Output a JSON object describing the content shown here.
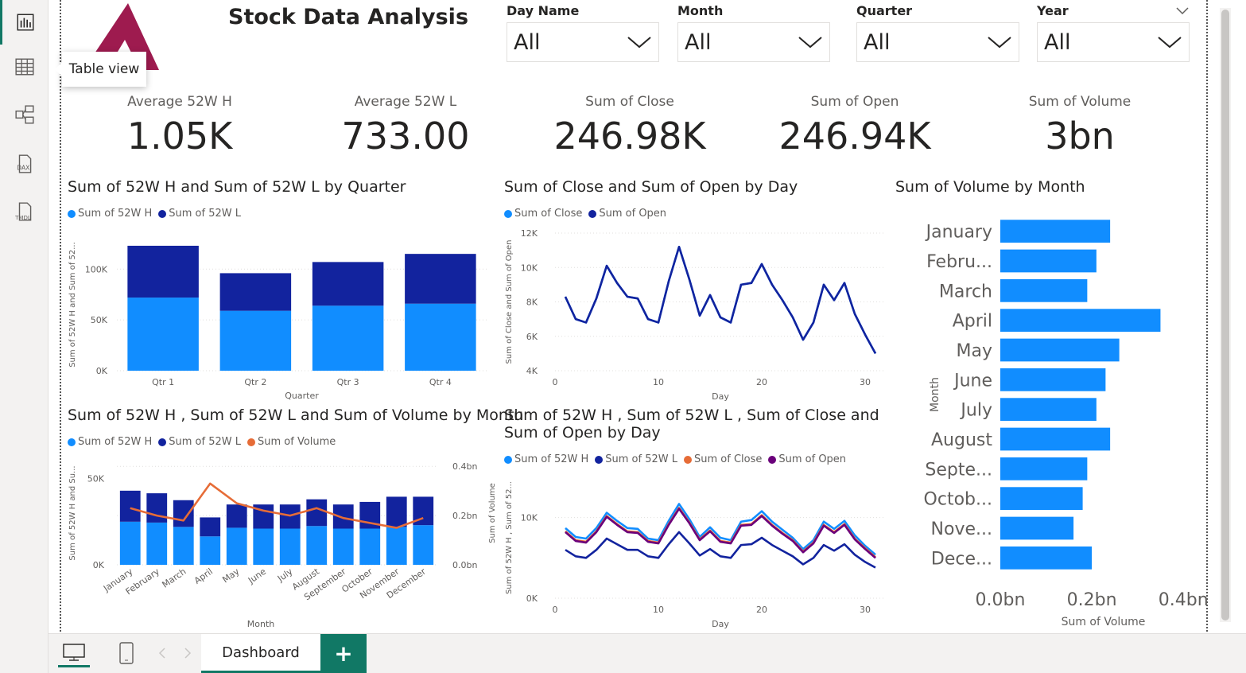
{
  "rail": {
    "items": [
      "report-view",
      "table-view",
      "model-view",
      "dax-query-view",
      "tmdl-view"
    ],
    "tooltip": "Table view",
    "dax_label": "DAX",
    "tmdl_label": "TMDL"
  },
  "header": {
    "title": "Stock Data Analysis"
  },
  "slicers": [
    {
      "label": "Day Name",
      "value": "All"
    },
    {
      "label": "Month",
      "value": "All"
    },
    {
      "label": "Quarter",
      "value": "All"
    },
    {
      "label": "Year",
      "value": "All"
    }
  ],
  "kpis": [
    {
      "label": "Average 52W H",
      "value": "1.05K"
    },
    {
      "label": "Average 52W L",
      "value": "733.00"
    },
    {
      "label": "Sum of Close",
      "value": "246.98K"
    },
    {
      "label": "Sum of Open",
      "value": "246.94K"
    },
    {
      "label": "Sum of Volume",
      "value": "3bn"
    }
  ],
  "colors": {
    "light_blue": "#118DFF",
    "dark_blue": "#12239E",
    "orange": "#E66C37",
    "purple": "#6B007B",
    "accent_green": "#117865",
    "logo": "#9E1B4F"
  },
  "chart_data": [
    {
      "type": "bar",
      "stacked": true,
      "title": "Sum of 52W H and Sum of 52W L by Quarter",
      "xlabel": "Quarter",
      "ylabel": "Sum of 52W H and Sum of 52...",
      "categories": [
        "Qtr 1",
        "Qtr 2",
        "Qtr 3",
        "Qtr 4"
      ],
      "series": [
        {
          "name": "Sum of 52W H",
          "values": [
            72000,
            59000,
            64000,
            66000
          ]
        },
        {
          "name": "Sum of 52W L",
          "values": [
            51000,
            37000,
            43000,
            49000
          ]
        }
      ],
      "ylim": [
        0,
        130000
      ],
      "yticks": [
        "0K",
        "50K",
        "100K"
      ],
      "ytick_values": [
        0,
        50000,
        100000
      ]
    },
    {
      "type": "line",
      "title": "Sum of Close and Sum of Open by Day",
      "xlabel": "Day",
      "ylabel": "Sum of Close and Sum of Open",
      "x": [
        1,
        2,
        3,
        4,
        5,
        6,
        7,
        8,
        9,
        10,
        11,
        12,
        13,
        14,
        15,
        16,
        17,
        18,
        19,
        20,
        21,
        22,
        23,
        24,
        25,
        26,
        27,
        28,
        29,
        30,
        31
      ],
      "series": [
        {
          "name": "Sum of Close",
          "values": [
            8300,
            7000,
            6800,
            8200,
            10100,
            9100,
            8300,
            8200,
            7000,
            6800,
            9200,
            11200,
            9300,
            7200,
            8400,
            7100,
            6800,
            9000,
            9100,
            10200,
            9000,
            8100,
            7100,
            5800,
            6800,
            9000,
            8100,
            9100,
            7300,
            6100,
            5000
          ]
        },
        {
          "name": "Sum of Open",
          "values": [
            8300,
            7000,
            6800,
            8200,
            10100,
            9100,
            8300,
            8200,
            7000,
            6800,
            9200,
            11200,
            9300,
            7200,
            8400,
            7100,
            6800,
            9000,
            9100,
            10200,
            9000,
            8100,
            7100,
            5800,
            6800,
            9000,
            8100,
            9100,
            7300,
            6100,
            5000
          ]
        }
      ],
      "xlim": [
        0,
        32
      ],
      "ylim": [
        4000,
        12000
      ],
      "xticks": [
        0,
        10,
        20,
        30
      ],
      "yticks": [
        "4K",
        "6K",
        "8K",
        "10K",
        "12K"
      ],
      "ytick_values": [
        4000,
        6000,
        8000,
        10000,
        12000
      ]
    },
    {
      "type": "bar",
      "orientation": "horizontal",
      "title": "Sum of Volume by Month",
      "xlabel": "Sum of Volume",
      "ylabel": "Month",
      "categories": [
        "January",
        "Febru...",
        "March",
        "April",
        "May",
        "June",
        "July",
        "August",
        "Septe...",
        "Octob...",
        "Nove...",
        "Dece..."
      ],
      "values": [
        0.24,
        0.21,
        0.19,
        0.35,
        0.26,
        0.23,
        0.21,
        0.24,
        0.19,
        0.18,
        0.16,
        0.2
      ],
      "xlim": [
        0,
        0.45
      ],
      "xticks": [
        "0.0bn",
        "0.2bn",
        "0.4bn"
      ],
      "xtick_values": [
        0,
        0.2,
        0.4
      ]
    },
    {
      "type": "bar",
      "stacked": true,
      "combo_line": true,
      "title": "Sum of 52W H , Sum of 52W L and Sum of Volume by Month",
      "xlabel": "Month",
      "ylabel": "Sum of 52W H and Su...",
      "y2label": "Sum of Volume",
      "categories": [
        "January",
        "February",
        "March",
        "April",
        "May",
        "June",
        "July",
        "August",
        "September",
        "October",
        "November",
        "December"
      ],
      "series": [
        {
          "name": "Sum of 52W H",
          "values": [
            25000,
            24500,
            22000,
            16500,
            21500,
            21000,
            21000,
            22500,
            21000,
            21000,
            22000,
            23000
          ]
        },
        {
          "name": "Sum of 52W L",
          "values": [
            18000,
            17000,
            15500,
            11000,
            13500,
            14000,
            14000,
            15500,
            14000,
            15500,
            17500,
            16500
          ]
        }
      ],
      "line_series": {
        "name": "Sum of Volume",
        "values": [
          0.23,
          0.2,
          0.18,
          0.33,
          0.25,
          0.22,
          0.2,
          0.23,
          0.19,
          0.17,
          0.15,
          0.19
        ]
      },
      "ylim": [
        0,
        60000
      ],
      "y2lim": [
        0,
        0.42
      ],
      "yticks": [
        "0K",
        "50K"
      ],
      "ytick_values": [
        0,
        50000
      ],
      "y2ticks": [
        "0.0bn",
        "0.2bn",
        "0.4bn"
      ],
      "y2tick_values": [
        0,
        0.2,
        0.4
      ]
    },
    {
      "type": "line",
      "title": "Sum of 52W H , Sum of 52W L , Sum of Close and Sum of Open by Day",
      "title_lines": [
        "Sum of 52W H , Sum of 52W L , Sum of Close and",
        "Sum of Open by Day"
      ],
      "xlabel": "Day",
      "ylabel": "Sum of 52W H , Sum of 52...",
      "x": [
        1,
        2,
        3,
        4,
        5,
        6,
        7,
        8,
        9,
        10,
        11,
        12,
        13,
        14,
        15,
        16,
        17,
        18,
        19,
        20,
        21,
        22,
        23,
        24,
        25,
        26,
        27,
        28,
        29,
        30,
        31
      ],
      "series": [
        {
          "name": "Sum of 52W H",
          "values": [
            8700,
            7600,
            7400,
            8700,
            10600,
            9600,
            8700,
            8600,
            7400,
            7200,
            9600,
            11700,
            9800,
            7600,
            8800,
            7500,
            7200,
            9500,
            9700,
            10800,
            9500,
            8500,
            7500,
            6100,
            7200,
            9500,
            8600,
            9600,
            7800,
            6500,
            5400
          ]
        },
        {
          "name": "Sum of 52W L",
          "values": [
            6000,
            5200,
            5000,
            6000,
            7400,
            6700,
            6000,
            6000,
            5200,
            5000,
            6700,
            8200,
            6800,
            5300,
            6100,
            5200,
            5000,
            6600,
            6700,
            7500,
            6600,
            5900,
            5200,
            4200,
            5000,
            6600,
            5900,
            6700,
            5400,
            4500,
            3800
          ]
        },
        {
          "name": "Sum of Close",
          "values": [
            8300,
            7200,
            7000,
            8300,
            10200,
            9200,
            8300,
            8200,
            7100,
            6900,
            9200,
            11200,
            9400,
            7300,
            8400,
            7100,
            6900,
            9100,
            9200,
            10300,
            9100,
            8100,
            7200,
            5800,
            6900,
            9100,
            8200,
            9200,
            7400,
            6200,
            5100
          ]
        },
        {
          "name": "Sum of Open",
          "values": [
            8200,
            7100,
            6900,
            8200,
            10100,
            9100,
            8200,
            8100,
            7000,
            6800,
            9100,
            11100,
            9300,
            7200,
            8300,
            7000,
            6800,
            9000,
            9100,
            10200,
            9000,
            8000,
            7100,
            5700,
            6800,
            9000,
            8100,
            9100,
            7300,
            6100,
            5000
          ]
        }
      ],
      "xlim": [
        0,
        32
      ],
      "ylim": [
        0,
        15000
      ],
      "xticks": [
        0,
        10,
        20,
        30
      ],
      "yticks": [
        "0K",
        "10K"
      ],
      "ytick_values": [
        0,
        10000
      ]
    }
  ],
  "footer": {
    "tab": "Dashboard",
    "add_tab": "+"
  }
}
